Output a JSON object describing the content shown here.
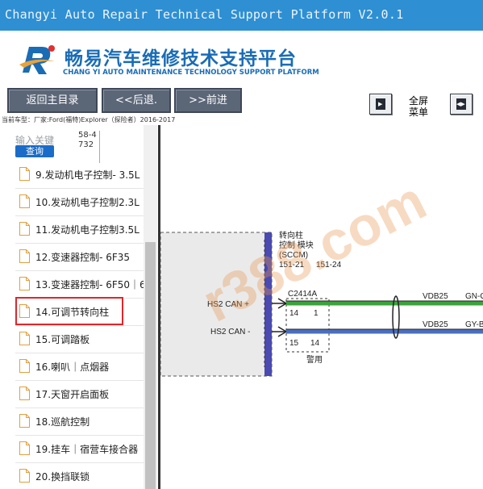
{
  "window": {
    "title": "Changyi Auto Repair Technical Support Platform V2.0.1"
  },
  "banner": {
    "title_cn": "畅易汽车维修技术支持平台",
    "title_en": "CHANG YI AUTO MAINTENANCE TECHNOLOGY SUPPORT PLATFORM",
    "logo_icon": "changyi-r-logo"
  },
  "toolbar": {
    "home_label": "返回主目录",
    "back_label": "<<后退.",
    "forward_label": ">>前进",
    "fullscreen_line1": "全屏",
    "fullscreen_line2": "菜单"
  },
  "car_info": "当前车型：厂家:Ford(福特)Explorer（探险者）2016-2017",
  "search": {
    "placeholder": "输入关键",
    "button_label": "查询",
    "code": "58-4732"
  },
  "sidebar": {
    "items": [
      {
        "label": "9.发动机电子控制- 3.5L"
      },
      {
        "label": "10.发动机电子控制2.3L"
      },
      {
        "label": "11.发动机电子控制3.5L"
      },
      {
        "label": "12.变速器控制- 6F35"
      },
      {
        "label": "13.变速器控制- 6F50｜6"
      },
      {
        "label": "14.可调节转向柱",
        "highlighted": true
      },
      {
        "label": "15.可调踏板"
      },
      {
        "label": "16.喇叭｜点烟器"
      },
      {
        "label": "17.天窗开启面板"
      },
      {
        "label": "18.巡航控制"
      },
      {
        "label": "19.挂车｜宿营车接合器"
      },
      {
        "label": "20.换挡联锁"
      }
    ]
  },
  "diagram": {
    "module_line1": "转向柱",
    "module_line2": "控制 模块",
    "module_line3": "(SCCM)",
    "part1": "151-21",
    "part2": "151-24",
    "connector": "C2414A",
    "hs2_plus": "HS2 CAN +",
    "hs2_minus": "HS2 CAN -",
    "pin_14": "14",
    "pin_1": "1",
    "pin_15": "15",
    "pin_14b": "14",
    "vdb1": "VDB25",
    "vdb2": "VDB25",
    "wire1": "GN-O",
    "wire2": "GY-B",
    "alarm": "警用",
    "wire1_color": "#3aa33a",
    "wire2_color": "#4a6fc0",
    "watermark": "r388.com"
  }
}
